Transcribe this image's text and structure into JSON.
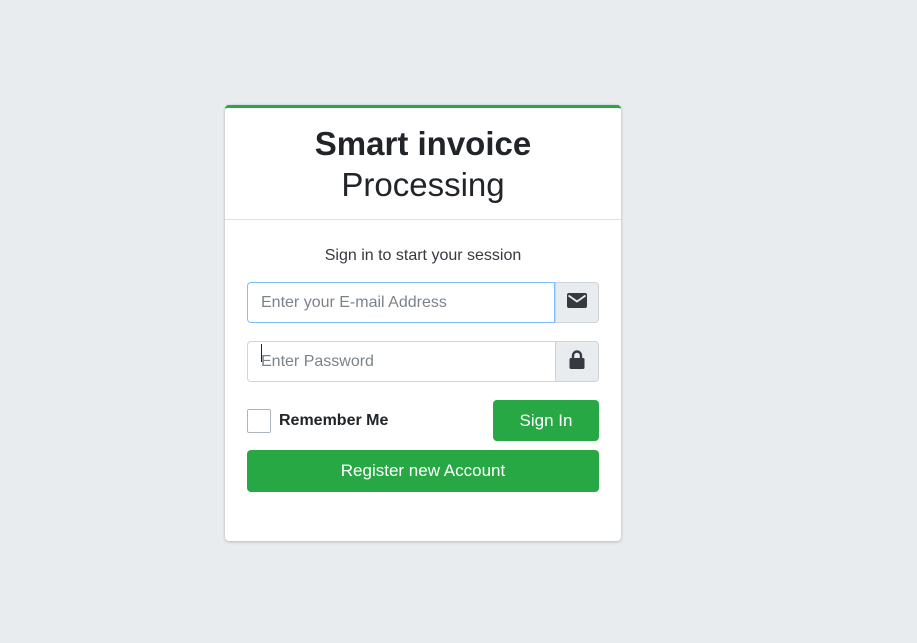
{
  "header": {
    "title_strong": "Smart invoice",
    "title_light": "Processing"
  },
  "login": {
    "message": "Sign in to start your session",
    "email_placeholder": "Enter your E-mail Address",
    "email_value": "",
    "password_placeholder": "Enter Password",
    "password_value": "",
    "remember_label": "Remember Me",
    "remember_checked": false,
    "signin_label": "Sign In",
    "register_label": "Register new Account"
  },
  "icons": {
    "email": "envelope-icon",
    "password": "lock-icon"
  },
  "colors": {
    "accent": "#28a745",
    "background": "#e9ecef",
    "focus_border": "#80bdff"
  }
}
